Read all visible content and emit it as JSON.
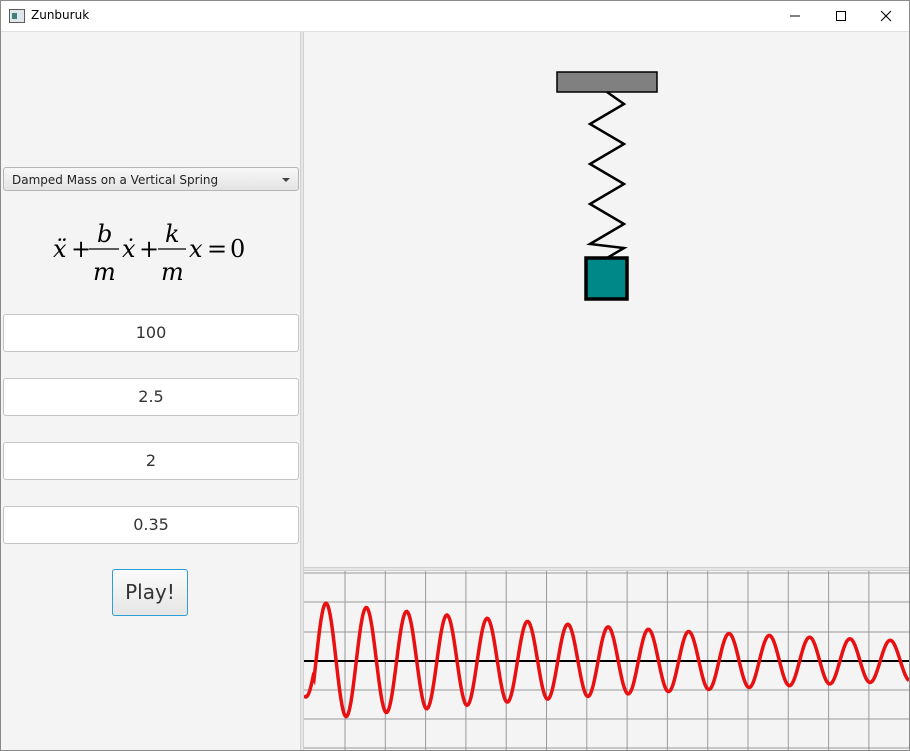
{
  "window": {
    "title": "Zunburuk",
    "controls": [
      "minimize-icon",
      "maximize-icon",
      "close-icon"
    ]
  },
  "left_panel": {
    "system_select": {
      "selected": "Damped Mass on a Vertical Spring"
    },
    "equation": {
      "term1": "ẍ",
      "plus1": "+",
      "frac1_num": "b",
      "frac1_den": "m",
      "term2": "ẋ",
      "plus2": "+",
      "frac2_num": "k",
      "frac2_den": "m",
      "term3": "x",
      "equals": "=",
      "rhs": "0"
    },
    "inputs": [
      {
        "value": "100"
      },
      {
        "value": "2.5"
      },
      {
        "value": "2"
      },
      {
        "value": "0.35"
      }
    ],
    "play_label": "Play!"
  },
  "simulation": {
    "ceiling_color": "#808080",
    "mass_color": "#008787",
    "spring_color": "#000000"
  },
  "graph": {
    "line_color": "#e81010",
    "axis_color": "#000000",
    "grid_color": "#9a9a9a"
  }
}
